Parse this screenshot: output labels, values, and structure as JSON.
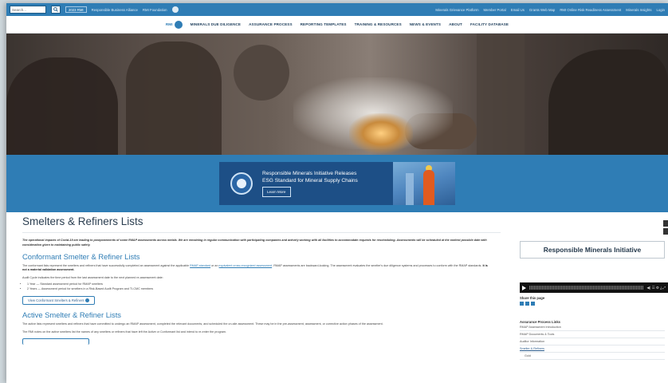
{
  "utility_bar": {
    "search_placeholder": "Search...",
    "pill": "2023 RMI",
    "links": [
      "Responsible Business Alliance",
      "RMI Foundation"
    ],
    "right_links": [
      "Minerals Grievance Platform",
      "Member Portal",
      "Email Us",
      "Grants Web Map",
      "RMI Online Risk Readiness Assessment",
      "Minerals Insights",
      "Login"
    ]
  },
  "main_nav": {
    "logo_text": "RMI",
    "items": [
      "MINERALS DUE DILIGENCE",
      "ASSURANCE PROCESS",
      "REPORTING TEMPLATES",
      "TRAINING & RESOURCES",
      "NEWS & EVENTS",
      "ABOUT",
      "FACILITY DATABASE"
    ]
  },
  "banner": {
    "line1": "Responsible Minerals Initiative Releases",
    "line2": "ESG Standard for Mineral Supply Chains",
    "button": "Learn More"
  },
  "main": {
    "title": "Smelters & Refiners Lists",
    "notice": "The operational impacts of Covid-19 are leading to postponements of some RMAP assessments across metals. We are remaining in regular communication with participating companies and actively working with all facilities to accommodate requests for rescheduling. Assessments will be scheduled at the earliest possible date with consideration given to maintaining public safety.",
    "conformant": {
      "heading": "Conformant Smelter & Refiner Lists",
      "para1_start": "The conformant lists represent the smelters and refiners that have successfully completed an assessment against the applicable",
      "para1_link1": "RMAP standard",
      "para1_mid": "or an",
      "para1_link2": "equivalent cross-recognized assessment",
      "para1_end": ". RMAP assessments are backward-looking. The assessment evaluates the smelter's due diligence systems and processes to conform with the RMAP standards.",
      "para1_bold": "It is not a material validation assessment.",
      "para2": "Audit Cycle indicates the time period from the last assessment date to the next planned re-assessment date:",
      "bullet1": "1 Year — Standard assessment period for RMAP smelters",
      "bullet2": "2 Years — Assessment period for smelters in a Risk-Based Audit Program and TI-CMC members",
      "button": "View Conformant Smelters & Refiners"
    },
    "active": {
      "heading": "Active Smelter & Refiner Lists",
      "para1": "The active lists represent smelters and refiners that have committed to undergo an RMAP assessment, completed the relevant documents, and scheduled the on-site assessment. These may be in the pre-assessment, assessment, or corrective action phases of the assessment.",
      "para2": "The RMI notes on the active smelters list the names of any smelters or refiners that have left the Active or Conformant list and intend to re-enter the program."
    }
  },
  "sidebar": {
    "org_name": "Responsible Minerals Initiative",
    "player_icons": "◀) ☰ ⚙ ⤓ ⤢",
    "share_label": "Share this page",
    "links_title": "Assurance Process Links",
    "links": [
      "RMAP Assessment Introduction",
      "RMAP Documents & Tools",
      "Auditor Information",
      "Smelter & Refiners",
      "Gold"
    ]
  }
}
